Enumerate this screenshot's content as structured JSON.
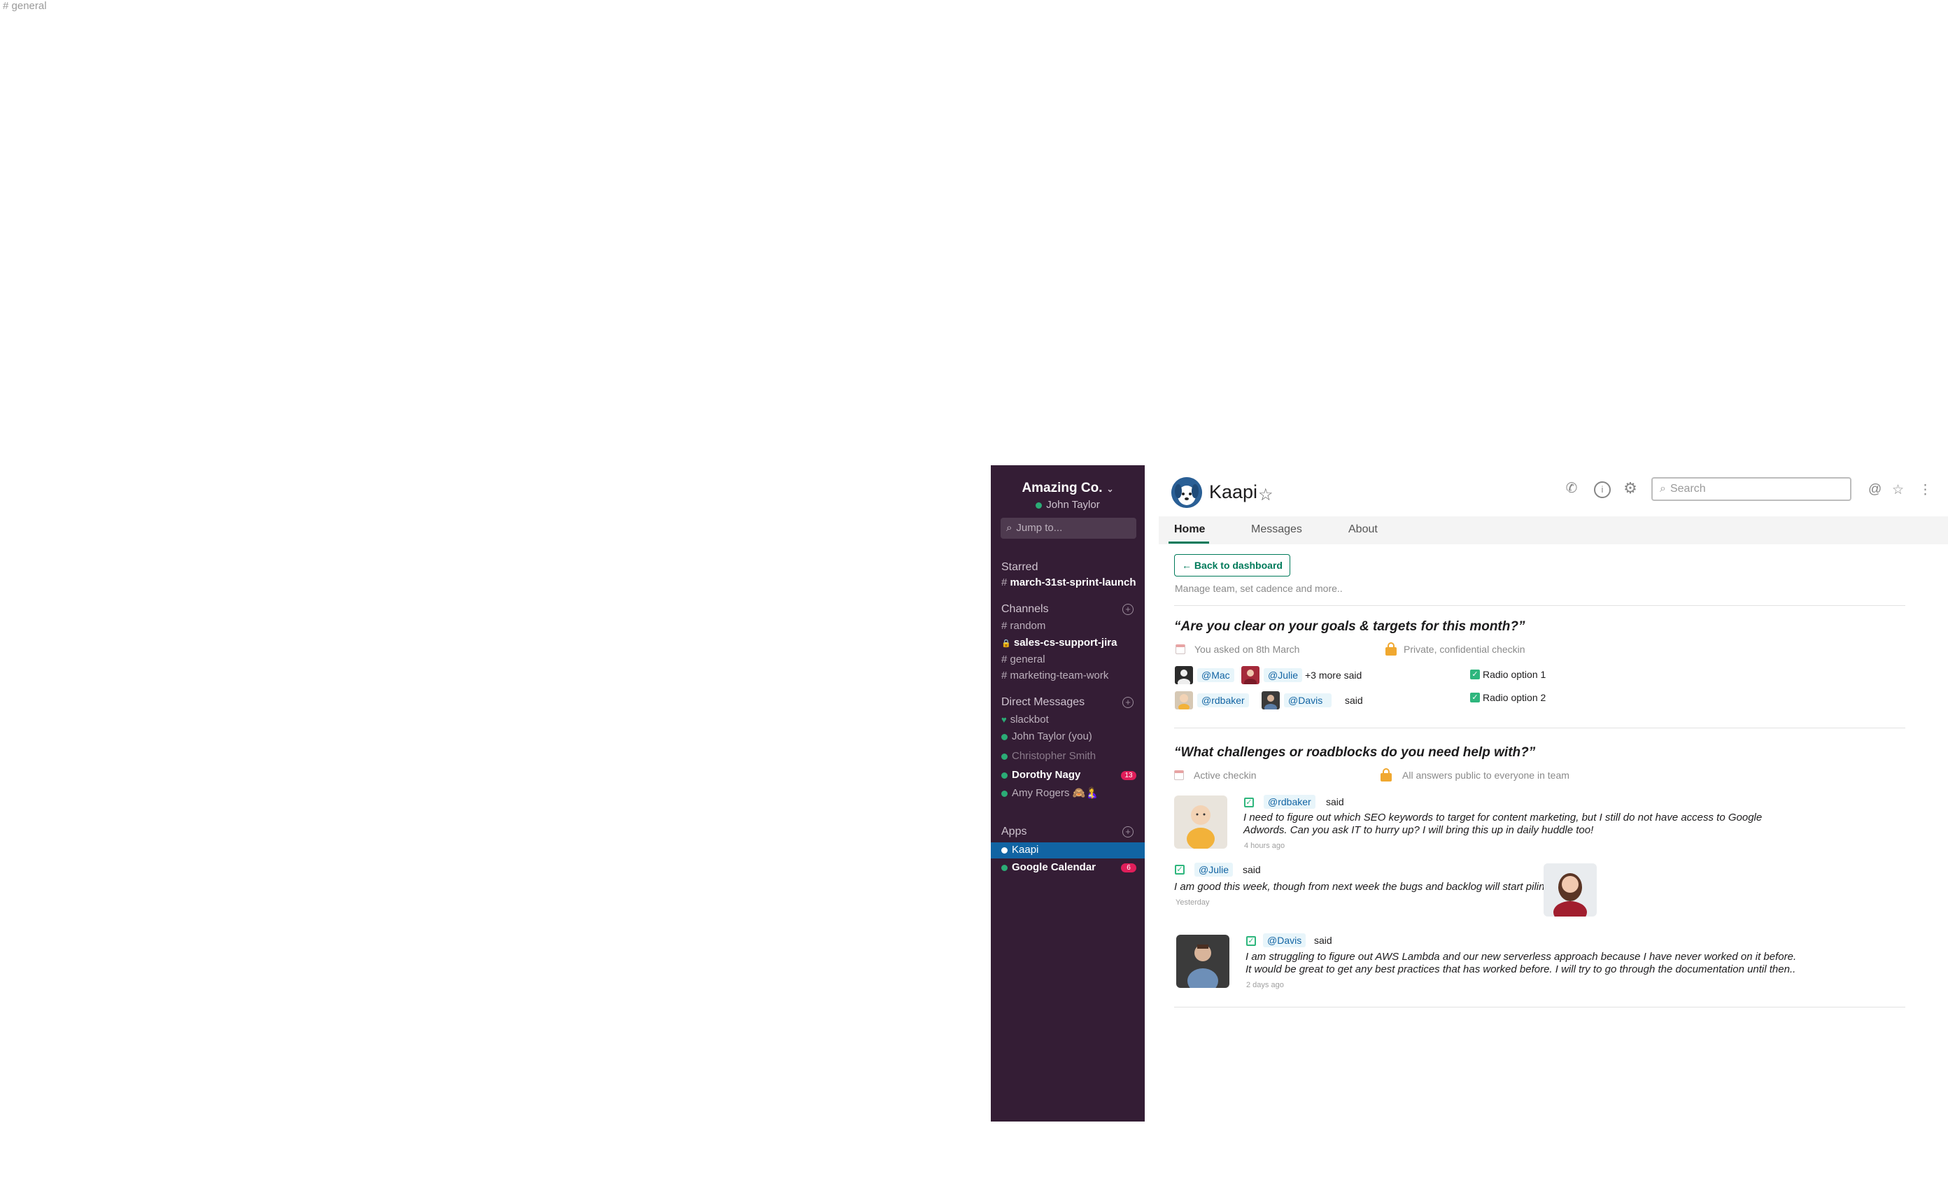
{
  "corner_label": "# general",
  "sidebar": {
    "workspace": "Amazing Co.",
    "user": "John Taylor",
    "jump_placeholder": "Jump to...",
    "starred_head": "Starred",
    "starred": [
      {
        "prefix": "#",
        "label": "march-31st-sprint-launch"
      }
    ],
    "channels_head": "Channels",
    "channels": [
      {
        "prefix": "#",
        "label": "random"
      },
      {
        "prefix": "lock",
        "label": "sales-cs-support-jira"
      },
      {
        "prefix": "#",
        "label": "general"
      },
      {
        "prefix": "#",
        "label": "marketing-team-work"
      }
    ],
    "dm_head": "Direct Messages",
    "dms": [
      {
        "label": "slackbot"
      },
      {
        "label": "John Taylor (you)"
      },
      {
        "label": "Christopher Smith"
      },
      {
        "label": "Dorothy Nagy",
        "badge": "13"
      },
      {
        "label": "Amy Rogers 🙈🤱"
      }
    ],
    "apps_head": "Apps",
    "apps": [
      {
        "label": "Kaapi"
      },
      {
        "label": "Google Calendar",
        "badge": "6"
      }
    ]
  },
  "app": {
    "title": "Kaapi",
    "search_placeholder": "Search",
    "tabs": [
      "Home",
      "Messages",
      "About"
    ],
    "back_button": "← Back to dashboard",
    "subtitle": "Manage team, set cadence and more.."
  },
  "checkin1": {
    "question": "“Are you clear on your goals & targets for this month?”",
    "asked": "You asked on 8th March",
    "privacy": "Private, confidential checkin",
    "row1": {
      "m1": "@Mac",
      "m2": "@Julie",
      "more": "+3 more said",
      "option": "Radio option 1"
    },
    "row2": {
      "m1": "@rdbaker",
      "m2": "@Davis",
      "said": "said",
      "option": "Radio option 2"
    }
  },
  "checkin2": {
    "question": "“What challenges or roadblocks do you need help with?”",
    "status": "Active checkin",
    "privacy": "All answers public to everyone in team",
    "answers": [
      {
        "user": "@rdbaker",
        "said": "said",
        "text": "I need to figure out which SEO keywords to target for content marketing, but I still do not have access to Google Adwords. Can you ask IT to hurry up? I will bring this up in daily huddle too!",
        "ago": "4 hours ago"
      },
      {
        "user": "@Julie",
        "said": "said",
        "text": "I am good this week, though from next week the bugs and backlog will start piling up",
        "ago": "Yesterday"
      },
      {
        "user": "@Davis",
        "said": "said",
        "text": "I am struggling to figure out AWS Lambda and our new serverless approach because I have never worked on it before. It would be great to get any best practices that has worked before. I will try to go through the documentation until then..",
        "ago": "2 days ago"
      }
    ]
  },
  "colors": {
    "sidebar": "#341d35",
    "active": "#1164a3",
    "accent": "#007a5a",
    "mention_bg": "#e8f5fa",
    "mention_fg": "#1264a3",
    "badge": "#e01e5a"
  }
}
